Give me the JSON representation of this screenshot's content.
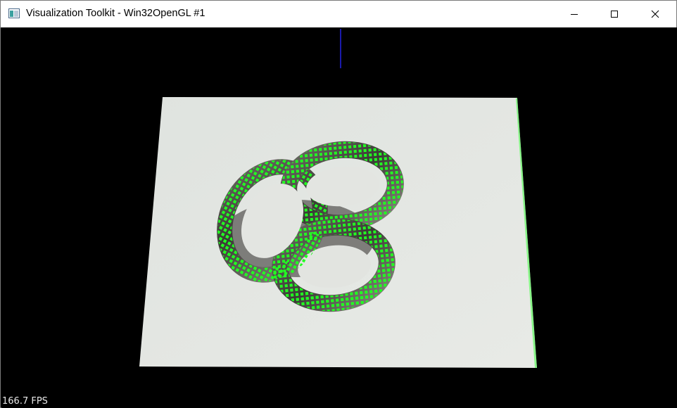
{
  "window": {
    "title": "Visualization Toolkit - Win32OpenGL #1",
    "icon": "vtk-window-icon",
    "controls": [
      "minimize-icon",
      "maximize-icon",
      "close-icon"
    ]
  },
  "scene": {
    "background_color": "#000000",
    "paper_color": "#e4e7e3",
    "ring_color": "#55524f",
    "point_color": "#22ff22",
    "axis_color": "#1a1aaa"
  },
  "overlay": {
    "fps": "166.7 FPS"
  }
}
